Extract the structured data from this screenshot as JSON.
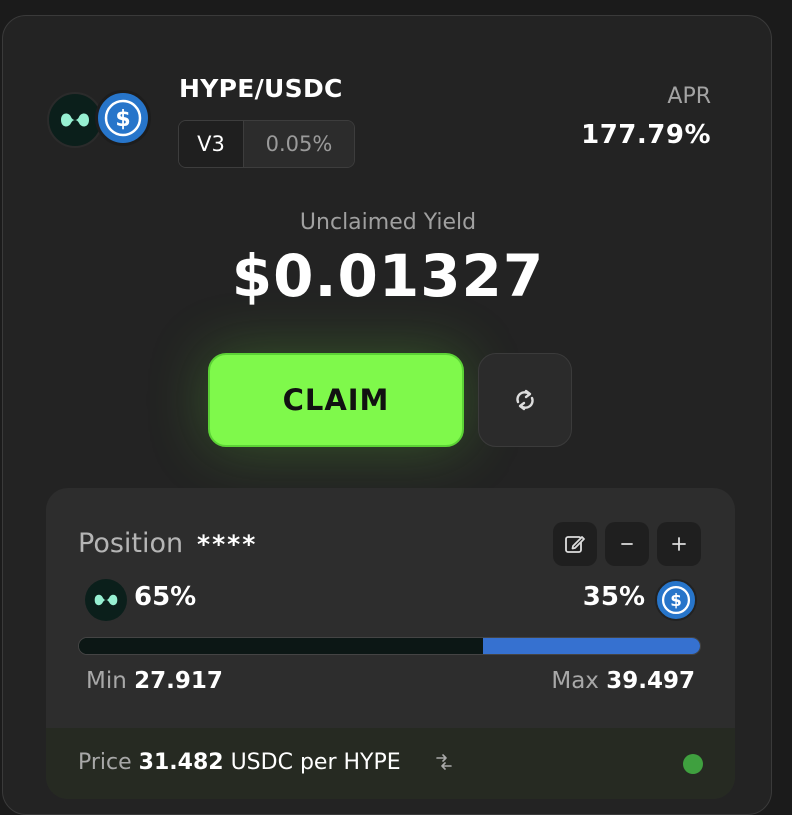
{
  "pair": {
    "title": "HYPE/USDC",
    "version": "V3",
    "fee": "0.05%",
    "token0_icon": "hype-token-icon",
    "token1_icon": "usdc-token-icon"
  },
  "apr": {
    "label": "APR",
    "value": "177.79%"
  },
  "yield": {
    "label": "Unclaimed Yield",
    "value": "$0.01327"
  },
  "actions": {
    "claim_label": "CLAIM",
    "refresh_icon": "refresh-icon"
  },
  "position": {
    "label": "Position",
    "masked_id": "****",
    "edit_icon": "edit-icon",
    "minus_icon": "minus-icon",
    "plus_icon": "plus-icon",
    "token0_pct": "65%",
    "token1_pct": "35%",
    "token0_fraction": 0.65,
    "min_label": "Min",
    "min_value": "27.917",
    "max_label": "Max",
    "max_value": "39.497"
  },
  "price": {
    "label": "Price",
    "value": "31.482",
    "unit": "USDC per HYPE",
    "swap_icon": "swap-direction-icon",
    "status": "in-range"
  },
  "colors": {
    "accent_green": "#7ff94b",
    "usdc_blue": "#3671d0",
    "hype_teal": "#97f0d2",
    "status_green": "#3fa03f"
  }
}
